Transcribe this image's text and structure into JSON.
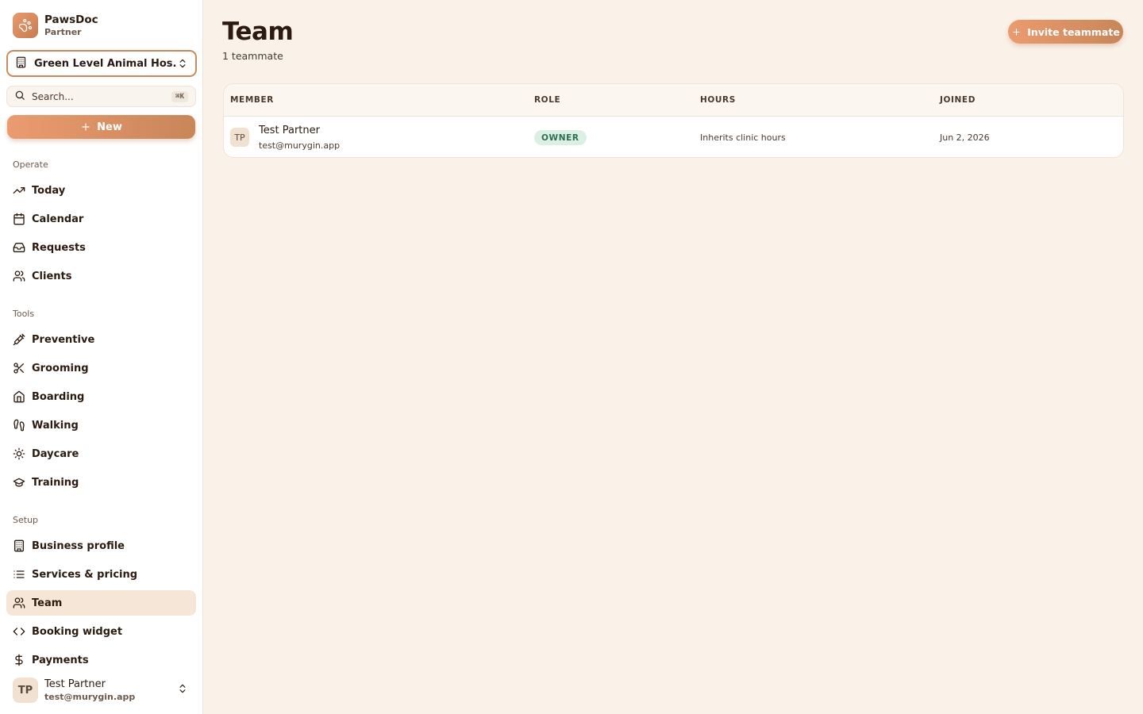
{
  "brand": {
    "name": "PawsDoc",
    "subtitle": "Partner",
    "icon": "paw-icon"
  },
  "clinic_selector": {
    "label": "Green Level Animal Hos...",
    "icon": "building-icon"
  },
  "search": {
    "placeholder": "Search...",
    "shortcut": "⌘K"
  },
  "new_button": {
    "label": "New"
  },
  "sections": {
    "operate": {
      "label": "Operate",
      "items": [
        {
          "label": "Today",
          "icon": "trending-up-icon"
        },
        {
          "label": "Calendar",
          "icon": "calendar-icon"
        },
        {
          "label": "Requests",
          "icon": "inbox-icon"
        },
        {
          "label": "Clients",
          "icon": "users-icon"
        }
      ]
    },
    "tools": {
      "label": "Tools",
      "items": [
        {
          "label": "Preventive",
          "icon": "syringe-icon"
        },
        {
          "label": "Grooming",
          "icon": "scissors-icon"
        },
        {
          "label": "Boarding",
          "icon": "home-icon"
        },
        {
          "label": "Walking",
          "icon": "footprints-icon"
        },
        {
          "label": "Daycare",
          "icon": "sun-icon"
        },
        {
          "label": "Training",
          "icon": "graduation-cap-icon"
        }
      ]
    },
    "setup": {
      "label": "Setup",
      "items": [
        {
          "label": "Business profile",
          "icon": "building-icon"
        },
        {
          "label": "Services & pricing",
          "icon": "list-icon"
        },
        {
          "label": "Team",
          "icon": "users-icon",
          "active": true
        },
        {
          "label": "Booking widget",
          "icon": "code-icon"
        },
        {
          "label": "Payments",
          "icon": "dollar-icon"
        }
      ]
    }
  },
  "user": {
    "initials": "TP",
    "name": "Test Partner",
    "email": "test@murygin.app"
  },
  "page": {
    "title": "Team",
    "subtitle": "1 teammate",
    "invite_label": "Invite teammate"
  },
  "table": {
    "columns": [
      "MEMBER",
      "ROLE",
      "HOURS",
      "JOINED"
    ],
    "rows": [
      {
        "initials": "TP",
        "name": "Test Partner",
        "email": "test@murygin.app",
        "role": "OWNER",
        "hours": "Inherits clinic hours",
        "joined": "Jun 2, 2026"
      }
    ]
  },
  "colors": {
    "accent": "#d88b5e",
    "background": "#faf1e8",
    "active_nav": "#f5e6d8",
    "owner_badge_bg": "#dcefe5",
    "owner_badge_text": "#2e6e4f"
  }
}
